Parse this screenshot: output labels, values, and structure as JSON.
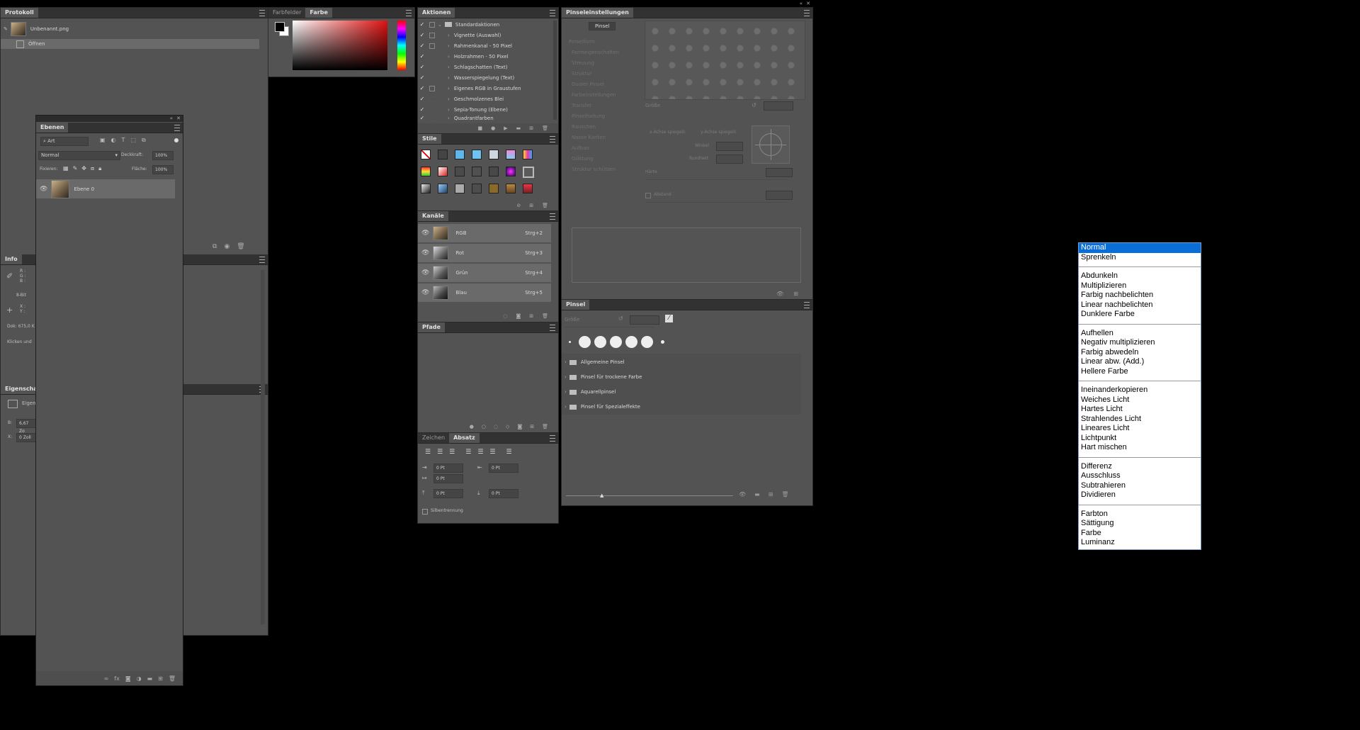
{
  "protokoll": {
    "tab": "Protokoll",
    "snapshot": "Unbenannt.png",
    "step": "Öffnen"
  },
  "color_panel": {
    "tabs": [
      "Farbfelder",
      "Farbe"
    ]
  },
  "ebenen": {
    "tab": "Ebenen",
    "filter": "Art",
    "blend": "Normal",
    "opacity_label": "Deckkraft:",
    "opacity": "100%",
    "lock_label": "Fixieren:",
    "fill_label": "Fläche:",
    "fill": "100%",
    "layer": "Ebene 0"
  },
  "info": {
    "tab": "Info",
    "rgb": "R :\nG :\nB :",
    "bit": "8-Bit",
    "xy": "X :\nY :",
    "doc": "Dok: 675,0 K",
    "hint": "Klicken und"
  },
  "eigenschaften": {
    "tab": "Eigenschafte",
    "item": "Eigen",
    "b": "B:",
    "b_val": "6,67 Zo",
    "x": "X:",
    "x_val": "0 Zoll"
  },
  "aktionen": {
    "tab": "Aktionen",
    "items": [
      "Standardaktionen",
      "Vignette (Auswahl)",
      "Rahmenkanal - 50 Pixel",
      "Holzrahmen - 50 Pixel",
      "Schlagschatten (Text)",
      "Wasserspiegelung (Text)",
      "Eigenes RGB in Graustufen",
      "Geschmolzenes Blei",
      "Sepia-Tonung (Ebene)",
      "Quadrantfarben"
    ]
  },
  "stile": {
    "tab": "Stile"
  },
  "kanaele": {
    "tab": "Kanäle",
    "items": [
      {
        "name": "RGB",
        "key": "Strg+2"
      },
      {
        "name": "Rot",
        "key": "Strg+3"
      },
      {
        "name": "Grün",
        "key": "Strg+4"
      },
      {
        "name": "Blau",
        "key": "Strg+5"
      }
    ]
  },
  "pfade": {
    "tab": "Pfade"
  },
  "absatz": {
    "tabs": [
      "Zeichen",
      "Absatz"
    ],
    "v1": "0 Pt",
    "v2": "0 Pt",
    "v3": "0 Pt",
    "v4": "0 Pt",
    "v5": "0 Pt",
    "hyphen": "Silbentrennung"
  },
  "pinseleinstellungen": {
    "tab": "Pinseleinstellungen",
    "pinsel_btn": "Pinsel",
    "options": [
      "Pinselform",
      "Formeigenschaften",
      "Streuung",
      "Struktur",
      "Dualer Pinsel",
      "Farbeinstellungen",
      "Transfer",
      "Pinselhaltung",
      "Rauschen",
      "Nasse Kanten",
      "Aufbau",
      "Glättung",
      "Struktur schützen"
    ],
    "groesse": "Größe",
    "flip_x": "x-Achse spiegeln",
    "flip_y": "y-Achse spiegeln",
    "winkel": "Winkel",
    "rundheit": "Rundheit",
    "haerte": "Härte",
    "abstand": "Abstand"
  },
  "pinsel": {
    "tab": "Pinsel",
    "groesse": "Größe",
    "folders": [
      "Allgemeine Pinsel",
      "Pinsel für trockene Farbe",
      "Aquarellpinsel",
      "Pinsel für Spezialeffekte"
    ]
  },
  "blend_menu": {
    "groups": [
      [
        "Normal",
        "Sprenkeln"
      ],
      [
        "Abdunkeln",
        "Multiplizieren",
        "Farbig nachbelichten",
        "Linear nachbelichten",
        "Dunklere Farbe"
      ],
      [
        "Aufhellen",
        "Negativ multiplizieren",
        "Farbig abwedeln",
        "Linear abw. (Add.)",
        "Hellere Farbe"
      ],
      [
        "Ineinanderkopieren",
        "Weiches Licht",
        "Hartes Licht",
        "Strahlendes Licht",
        "Lineares Licht",
        "Lichtpunkt",
        "Hart mischen"
      ],
      [
        "Differenz",
        "Ausschluss",
        "Subtrahieren",
        "Dividieren"
      ],
      [
        "Farbton",
        "Sättigung",
        "Farbe",
        "Luminanz"
      ]
    ],
    "selected": "Normal"
  },
  "colors": {
    "panel": "#535353",
    "header": "#323232",
    "selection": "#0a6ed8"
  }
}
